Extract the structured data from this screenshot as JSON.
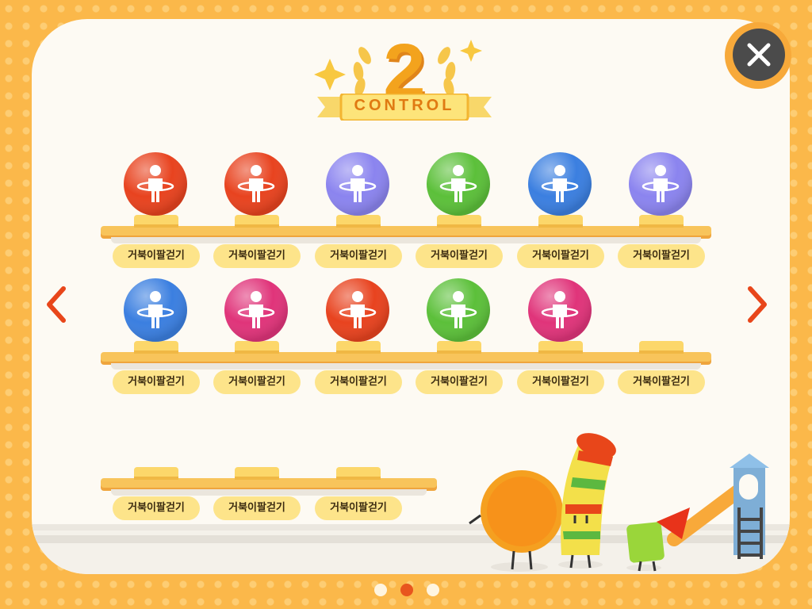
{
  "header": {
    "level_number": "2",
    "level_title": "CONTROL"
  },
  "buttons": {
    "close_icon": "close-icon",
    "prev_icon": "chevron-left-icon",
    "next_icon": "chevron-right-icon"
  },
  "colors": {
    "background": "#fbb84a",
    "panel": "#fdfaf3",
    "label_pill": "#fde48a",
    "arrow": "#e8461a",
    "pager_active": "#e8551e"
  },
  "shelves": [
    {
      "items": [
        {
          "label": "거북이팔걷기",
          "orb_color": "#e8431f",
          "icon": "hula-hoop-icon"
        },
        {
          "label": "거북이팔걷기",
          "orb_color": "#e8431f",
          "icon": "skateboard-icon"
        },
        {
          "label": "거북이팔걷기",
          "orb_color": "#8b84ef",
          "icon": "music-duo-icon"
        },
        {
          "label": "거북이팔걷기",
          "orb_color": "#5cc03a",
          "icon": "door-icon"
        },
        {
          "label": "거북이팔걷기",
          "orb_color": "#3b7fe0",
          "icon": "kangaroo-icon"
        },
        {
          "label": "거북이팔걷기",
          "orb_color": "#8b84ef",
          "icon": "handshake-icon"
        }
      ]
    },
    {
      "items": [
        {
          "label": "거북이팔걷기",
          "orb_color": "#3b7fe0",
          "icon": "golf-icon"
        },
        {
          "label": "거북이팔걷기",
          "orb_color": "#e0347a",
          "icon": "skier-icon"
        },
        {
          "label": "거북이팔걷기",
          "orb_color": "#e8431f",
          "icon": "stopwatch-icon"
        },
        {
          "label": "거북이팔걷기",
          "orb_color": "#5cc03a",
          "icon": "rabbit-icon"
        },
        {
          "label": "거북이팔걷기",
          "orb_color": "#e0347a",
          "icon": "trophy-laurel-icon"
        },
        {
          "label": "거북이팔걷기",
          "orb_color": "",
          "icon": "empty-slot"
        }
      ]
    },
    {
      "items": [
        {
          "label": "거북이팔걷기",
          "orb_color": "",
          "icon": "empty-slot"
        },
        {
          "label": "거북이팔걷기",
          "orb_color": "",
          "icon": "empty-slot"
        },
        {
          "label": "거북이팔걷기",
          "orb_color": "",
          "icon": "empty-slot"
        }
      ]
    }
  ],
  "pager": {
    "pages": 3,
    "active_index": 1
  },
  "decorations": [
    "cookie-character-icon",
    "striped-tube-character-icon",
    "green-block-character-icon",
    "playground-slide-icon"
  ]
}
